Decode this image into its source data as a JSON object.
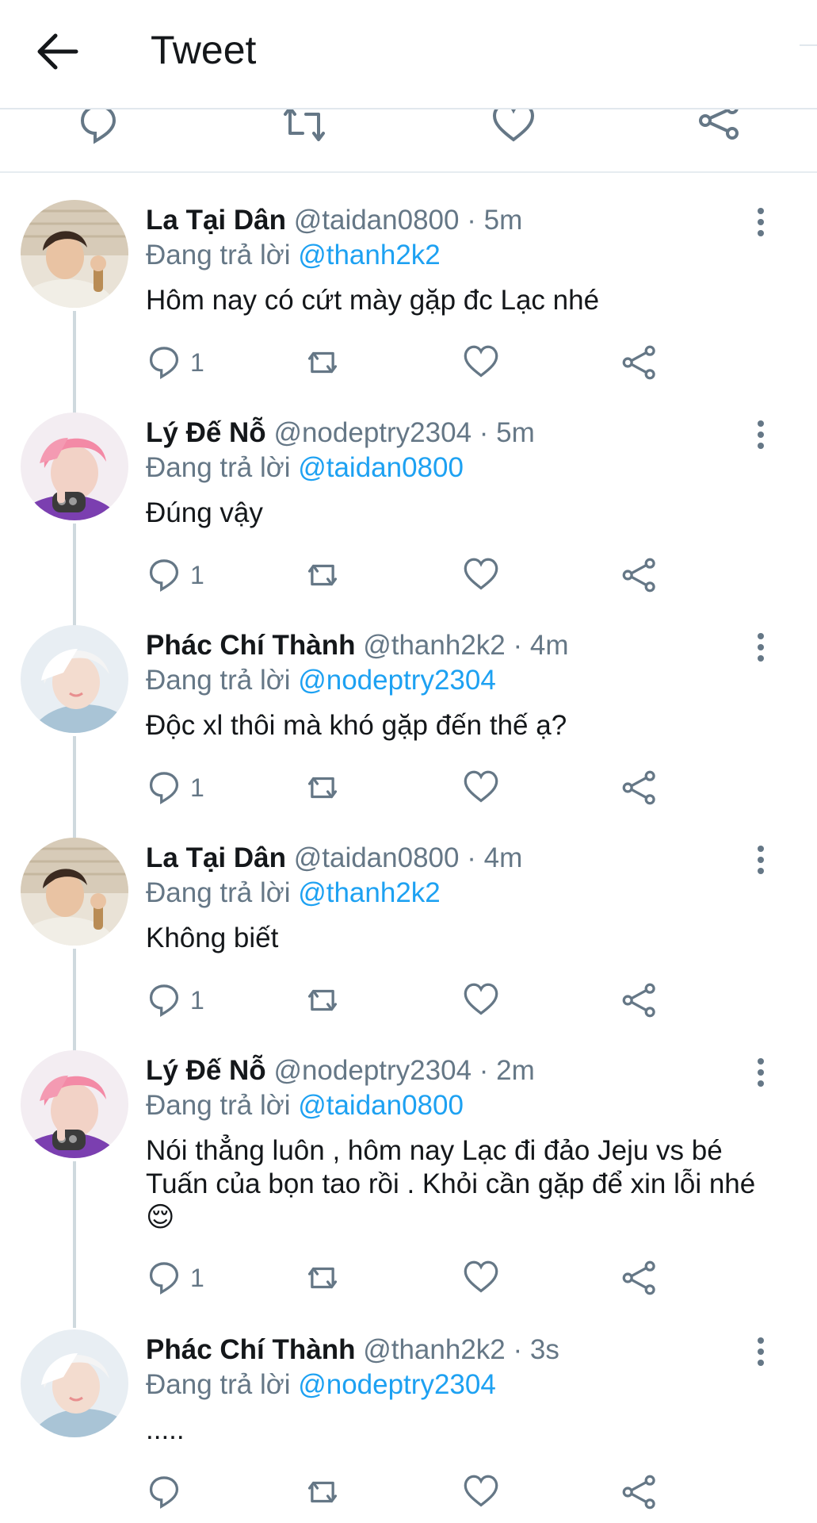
{
  "header": {
    "title": "Tweet"
  },
  "replies": [
    {
      "name": "La Tại Dân",
      "handle": "@taidan0800",
      "time": "5m",
      "replying_prefix": "Đang trả lời",
      "replying_to": "@thanh2k2",
      "text": "Hôm nay có cứt mày gặp đc Lạc nhé",
      "reply_count": "1",
      "avatar": "brown-hair-boy"
    },
    {
      "name": "Lý Đế Nỗ",
      "handle": "@nodeptry2304",
      "time": "5m",
      "replying_prefix": "Đang trả lời",
      "replying_to": "@taidan0800",
      "text": "Đúng vậy",
      "reply_count": "1",
      "avatar": "pink-hair-boy"
    },
    {
      "name": "Phác Chí Thành",
      "handle": "@thanh2k2",
      "time": "4m",
      "replying_prefix": "Đang trả lời",
      "replying_to": "@nodeptry2304",
      "text": "Độc xl thôi mà khó gặp đến thế ạ?",
      "reply_count": "1",
      "avatar": "white-hair-boy"
    },
    {
      "name": "La Tại Dân",
      "handle": "@taidan0800",
      "time": "4m",
      "replying_prefix": "Đang trả lời",
      "replying_to": "@thanh2k2",
      "text": "Không biết",
      "reply_count": "1",
      "avatar": "brown-hair-boy"
    },
    {
      "name": "Lý Đế Nỗ",
      "handle": "@nodeptry2304",
      "time": "2m",
      "replying_prefix": "Đang trả lời",
      "replying_to": "@taidan0800",
      "text": "Nói thẳng luôn , hôm nay Lạc đi đảo Jeju vs bé Tuấn của bọn tao rồi . Khỏi cần gặp để xin lỗi nhé😌",
      "reply_count": "1",
      "avatar": "pink-hair-boy"
    },
    {
      "name": "Phác Chí Thành",
      "handle": "@thanh2k2",
      "time": "3s",
      "replying_prefix": "Đang trả lời",
      "replying_to": "@nodeptry2304",
      "text": ".....",
      "reply_count": "",
      "avatar": "white-hair-boy"
    }
  ],
  "colors": {
    "accent": "#1da1f2",
    "secondary_text": "#657786",
    "divider": "#e1e8ed"
  }
}
